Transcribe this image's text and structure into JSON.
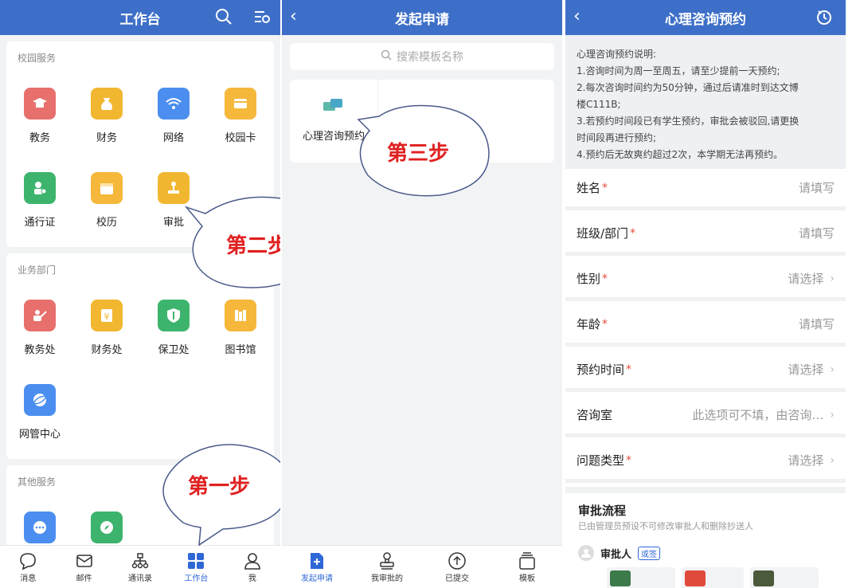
{
  "colors": {
    "brand": "#3e6fc8",
    "accent": "#2f68d6",
    "required": "#e74c3c",
    "callout": "#e02020"
  },
  "workbench": {
    "title": "工作台",
    "icons": [
      "search-icon",
      "settings-icon"
    ],
    "sections": [
      {
        "title": "校园服务",
        "apps": [
          {
            "label": "教务",
            "icon": "graduation-cap-icon",
            "color": "#e7706d"
          },
          {
            "label": "财务",
            "icon": "money-bag-icon",
            "color": "#f2b731"
          },
          {
            "label": "网络",
            "icon": "wifi-icon",
            "color": "#4b8ef0"
          },
          {
            "label": "校园卡",
            "icon": "card-icon",
            "color": "#f5b83a"
          },
          {
            "label": "通行证",
            "icon": "pass-icon",
            "color": "#3db46d"
          },
          {
            "label": "校历",
            "icon": "calendar-icon",
            "color": "#f5b83a"
          },
          {
            "label": "审批",
            "icon": "stamp-icon",
            "color": "#f2b731"
          }
        ]
      },
      {
        "title": "业务部门",
        "apps": [
          {
            "label": "教务处",
            "icon": "teacher-icon",
            "color": "#e7706d"
          },
          {
            "label": "财务处",
            "icon": "finance-icon",
            "color": "#f2b731"
          },
          {
            "label": "保卫处",
            "icon": "shield-icon",
            "color": "#3db46d"
          },
          {
            "label": "图书馆",
            "icon": "books-icon",
            "color": "#f5b83a"
          },
          {
            "label": "网管中心",
            "icon": "globe-icon",
            "color": "#4b8ef0"
          }
        ]
      },
      {
        "title": "其他服务",
        "apps": [
          {
            "label": "",
            "icon": "chat-icon",
            "color": "#4b8ef0"
          },
          {
            "label": "",
            "icon": "compass-icon",
            "color": "#3db46d"
          }
        ]
      }
    ],
    "tabs": [
      {
        "label": "消息",
        "icon": "message-icon"
      },
      {
        "label": "邮件",
        "icon": "mail-icon"
      },
      {
        "label": "通讯录",
        "icon": "contacts-icon"
      },
      {
        "label": "工作台",
        "icon": "grid-icon",
        "active": true
      },
      {
        "label": "我",
        "icon": "person-icon"
      }
    ]
  },
  "apply": {
    "title": "发起申请",
    "search_placeholder": "搜索模板名称",
    "templates": [
      {
        "label": "心理咨询预约",
        "icon": "chat-bubbles-icon"
      }
    ],
    "tabs": [
      {
        "label": "发起申请",
        "icon": "new-doc-icon",
        "active": true
      },
      {
        "label": "我审批的",
        "icon": "stamp-icon"
      },
      {
        "label": "已提交",
        "icon": "upload-icon"
      },
      {
        "label": "模板",
        "icon": "layers-icon"
      }
    ]
  },
  "form": {
    "title": "心理咨询预约",
    "notice": [
      "心理咨询预约说明:",
      "1.咨询时间为周一至周五，请至少提前一天预约;",
      "2.每次咨询时间约为50分钟，通过后请准时到达文博",
      "楼C111B;",
      "3.若预约时间段已有学生预约，审批会被驳回,请更换",
      "时间段再进行预约;",
      "4.预约后无故爽约超过2次，本学期无法再预约。"
    ],
    "fields": [
      {
        "label": "姓名",
        "required": true,
        "value": "请填写",
        "chevron": false
      },
      {
        "label": "班级/部门",
        "required": true,
        "value": "请填写",
        "chevron": false
      },
      {
        "label": "性别",
        "required": true,
        "value": "请选择",
        "chevron": true
      },
      {
        "label": "年龄",
        "required": true,
        "value": "请填写",
        "chevron": false
      },
      {
        "label": "预约时间",
        "required": true,
        "value": "请选择",
        "chevron": true
      },
      {
        "label": "咨询室",
        "required": false,
        "value": "此选项可不填，由咨询…",
        "chevron": true
      },
      {
        "label": "问题类型",
        "required": true,
        "value": "请选择",
        "chevron": true
      }
    ],
    "approval": {
      "title": "审批流程",
      "subtitle": "已由管理员预设不可修改审批人和删除抄送人",
      "approver_label": "审批人",
      "approver_badge": "或签"
    }
  },
  "callouts": {
    "step1": "第一步",
    "step2": "第二步",
    "step3": "第三步"
  }
}
